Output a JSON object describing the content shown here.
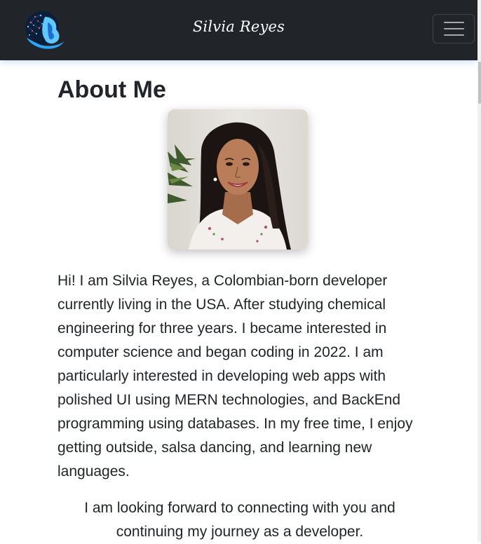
{
  "navbar": {
    "brand": "Silvia Reyes",
    "logo_icon": "digital-head-logo-icon",
    "menu_icon": "hamburger-menu-icon"
  },
  "about": {
    "title": "About Me",
    "photo_alt": "profile-photo",
    "bio": "Hi! I am Silvia Reyes, a Colombian-born developer currently living in the USA. After studying chemical engineering for three years. I became interested in computer science and began coding in 2022. I am particularly interested in developing web apps with polished UI using MERN technologies, and BackEnd programming using databases. In my free time, I enjoy getting outside, salsa dancing, and learning new languages.",
    "closing": "I am looking forward to connecting with you and continuing my journey as a developer."
  },
  "colors": {
    "navbar_bg": "#212529",
    "navbar_glow": "#5aa0e6",
    "text": "#212529",
    "logo_blue": "#1e90ff"
  }
}
